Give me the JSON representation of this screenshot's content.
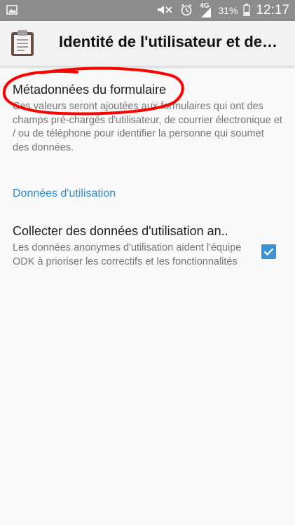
{
  "status_bar": {
    "network_label": "4G",
    "battery_percent": "31%",
    "time": "12:17",
    "icons": [
      "image-notification-icon",
      "mute-icon",
      "alarm-icon",
      "signal-icon",
      "battery-icon"
    ]
  },
  "app_bar": {
    "title": "Identité de l'utilisateur et de…",
    "icon": "clipboard-icon"
  },
  "preferences": {
    "form_metadata": {
      "title": "Métadonnées du formulaire",
      "summary": "Ces valeurs seront ajoutées aux formulaires qui ont des champs pré-chargés d'utilisateur, de courrier électronique et / ou de téléphone pour identifier la personne qui soumet des données."
    },
    "usage_category": "Données d'utilisation",
    "usage_data": {
      "title": "Collecter des données d'utilisation an..",
      "summary": "Les données anonymes d'utilisation aident l'équipe ODK à prioriser les correctifs et les fonctionnalités",
      "checked": true
    }
  },
  "colors": {
    "accent": "#2b8ad8",
    "checkbox": "#3b93d6",
    "annotation": "#ff0000",
    "status_bar": "#8c8c8c"
  }
}
